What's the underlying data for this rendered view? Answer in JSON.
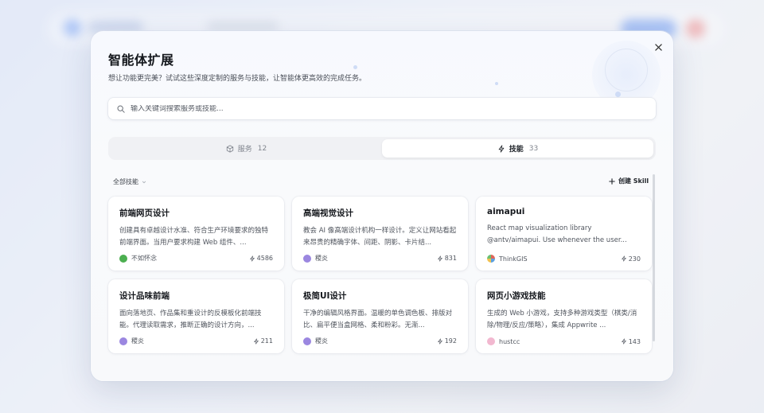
{
  "modal": {
    "title": "智能体扩展",
    "subtitle": "想让功能更完美？试试这些深度定制的服务与技能，让智能体更高效的完成任务。",
    "search_placeholder": "输入关键词搜索服务或技能...",
    "tabs": [
      {
        "label": "服务",
        "count": "12",
        "icon": "cube-icon",
        "active": false
      },
      {
        "label": "技能",
        "count": "33",
        "icon": "lightning-icon",
        "active": true
      }
    ],
    "filter_label": "全部技能",
    "create_label": "创建 Skill",
    "cards": [
      {
        "title": "前端网页设计",
        "desc": "创建具有卓越设计水准、符合生产环境要求的独特前端界面。当用户要求构建 Web 组件、...",
        "author": "不如怀念",
        "stars": "4586",
        "avatar_color": "#4caf50"
      },
      {
        "title": "高端视觉设计",
        "desc": "教会 AI 像高端设计机构一样设计。定义让网站看起来昂贵的精确字体、间距、阴影、卡片结...",
        "author": "稷炎",
        "stars": "831",
        "avatar_color": "#9b87e0"
      },
      {
        "title": "aimapui",
        "desc": "React map visualization library @antv/aimapui. Use whenever the user...",
        "author": "ThinkGIS",
        "stars": "230",
        "avatar_color": "#e0655a"
      },
      {
        "title": "设计品味前端",
        "desc": "面向落地页、作品集和重设计的反模板化前端技能。代理读取需求，推断正确的设计方向，...",
        "author": "稷炎",
        "stars": "211",
        "avatar_color": "#9b87e0"
      },
      {
        "title": "极简UI设计",
        "desc": "干净的编辑风格界面。温暖的单色调色板、排版对比、扁平便当盒网格、柔和粉彩。无渐...",
        "author": "稷炎",
        "stars": "192",
        "avatar_color": "#9b87e0"
      },
      {
        "title": "网页小游戏技能",
        "desc": "生成的 Web 小游戏，支持多种游戏类型（棋类/消除/物理/反应/策略），集成 Appwrite ...",
        "author": "hustcc",
        "stars": "143",
        "avatar_color": "#f2b8d0"
      }
    ]
  }
}
